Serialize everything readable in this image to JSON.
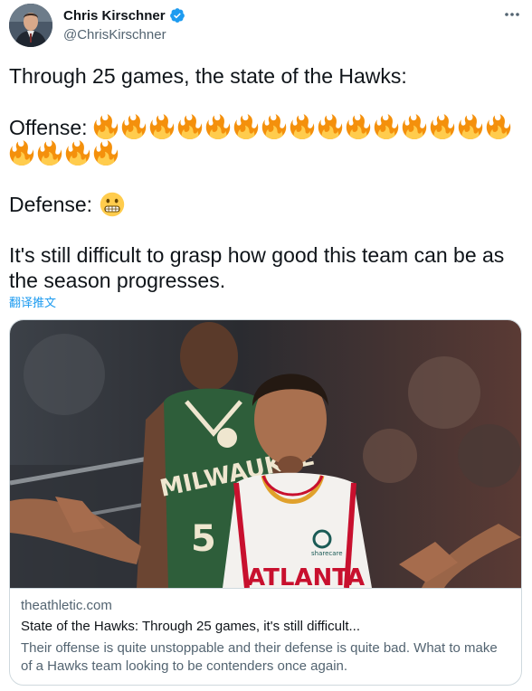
{
  "author": {
    "display_name": "Chris Kirschner",
    "handle": "@ChrisKirschner",
    "verified": true,
    "avatar_icon": "avatar-photo"
  },
  "tweet": {
    "line1": "Through 25 games, the state of the Hawks:",
    "offense_label": "Offense:",
    "offense_fire_count": 19,
    "defense_label": "Defense:",
    "defense_emoji": "grimacing-face-icon",
    "line3a": "It's still difficult to grasp how good this team can be as",
    "line3b": "the season progresses.",
    "translate_label": "翻译推文"
  },
  "card": {
    "domain": "theathletic.com",
    "title": "State of the Hawks: Through 25 games, it's still difficult...",
    "description": "Their offense is quite unstoppable and their defense is quite bad. What to make of a Hawks team looking to be contenders once again.",
    "image_jersey_text_back": "MILWAUKEE",
    "image_jersey_number": "5",
    "image_jersey_text_front": "ATLANTA",
    "image_sponsor": "sharecare"
  },
  "colors": {
    "accent": "#1d9bf0",
    "text": "#0f1419",
    "secondary": "#536471",
    "border": "#cfd9de"
  }
}
